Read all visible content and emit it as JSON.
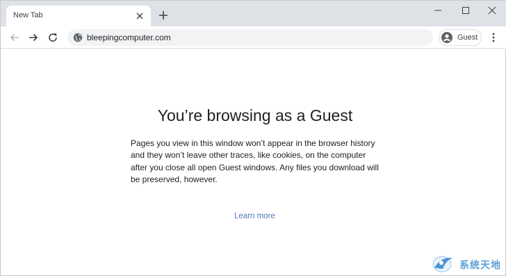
{
  "tab": {
    "title": "New Tab",
    "close_icon": "close-icon"
  },
  "toolbar": {
    "url": "bleepingcomputer.com",
    "profile_label": "Guest",
    "back_icon": "back-arrow-icon",
    "forward_icon": "forward-arrow-icon",
    "reload_icon": "reload-icon",
    "site_icon": "globe-icon",
    "menu_icon": "kebab-menu-icon"
  },
  "page": {
    "heading": "You’re browsing as a Guest",
    "body": "Pages you view in this window won’t appear in the browser history and they won’t leave other traces, like cookies, on the computer after you close all open Guest windows. Any files you download will be preserved, however.",
    "learn_more": "Learn more"
  },
  "watermark": {
    "text": "系统天地"
  },
  "colors": {
    "tabstrip": "#dee1e6",
    "omnibox": "#f1f3f4",
    "link": "#4e79b7",
    "text": "#202124"
  }
}
